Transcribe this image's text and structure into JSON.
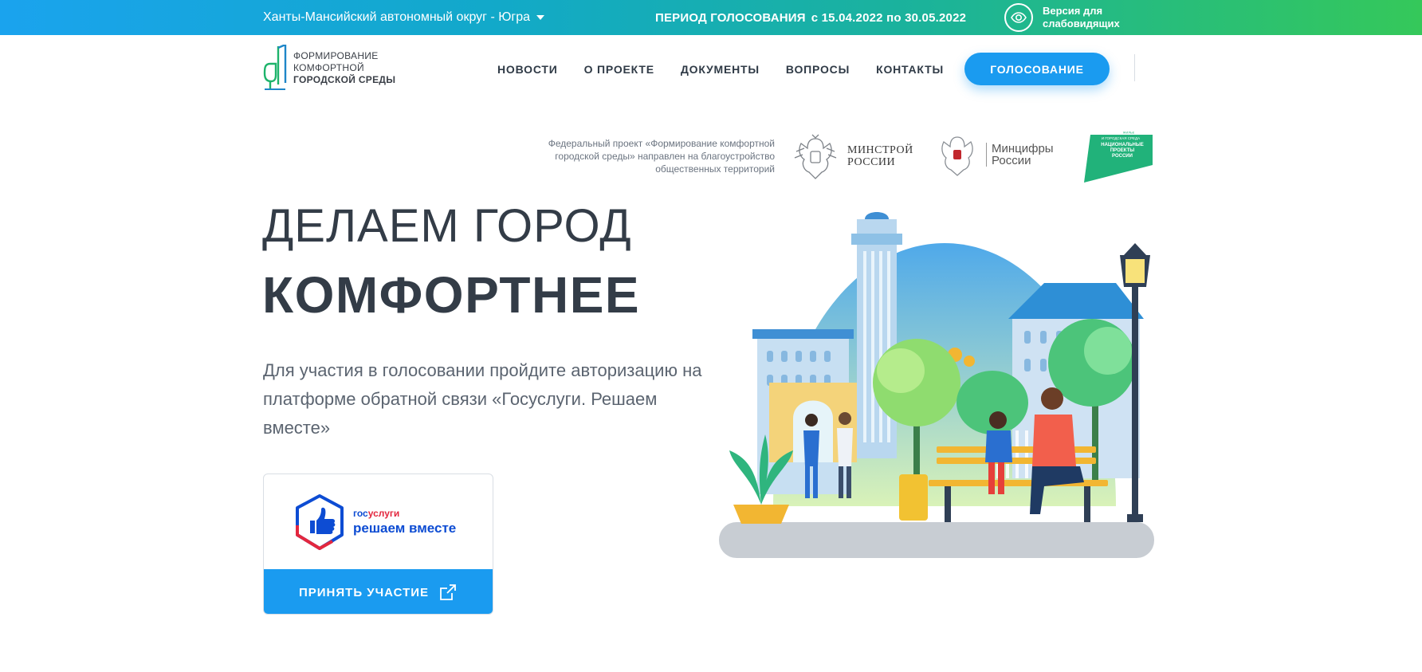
{
  "topbar": {
    "region": "Ханты-Мансийский автономный округ - Югра",
    "period_label": "ПЕРИОД ГОЛОСОВАНИЯ",
    "period_dates": "с 15.04.2022 по 30.05.2022",
    "accessibility_line1": "Версия для",
    "accessibility_line2": "слабовидящих"
  },
  "logo": {
    "line1": "ФОРМИРОВАНИЕ",
    "line2": "КОМФОРТНОЙ",
    "line3": "ГОРОДСКОЙ СРЕДЫ"
  },
  "nav": {
    "items": [
      "НОВОСТИ",
      "О ПРОЕКТЕ",
      "ДОКУМЕНТЫ",
      "ВОПРОСЫ",
      "КОНТАКТЫ"
    ],
    "vote_button": "ГОЛОСОВАНИЕ"
  },
  "partners": {
    "fed_text": "Федеральный проект «Формирование комфортной городской среды» направлен на благоустройство общественных территорий",
    "minstroy_line1": "МИНСТРОЙ",
    "minstroy_line2": "РОССИИ",
    "mincifry_line1": "Минцифры",
    "mincifry_line2": "России",
    "np_line1": "ЖИЛЬЕ",
    "np_line2": "И ГОРОДСКАЯ СРЕДА",
    "np_line3": "НАЦИОНАЛЬНЫЕ",
    "np_line4": "ПРОЕКТЫ",
    "np_line5": "РОССИИ"
  },
  "hero": {
    "title_line1": "ДЕЛАЕМ ГОРОД",
    "title_line2": "КОМФОРТНЕЕ",
    "description": "Для участия в голосовании пройдите авторизацию на платформе обратной связи «Госуслуги. Решаем вместе»"
  },
  "card": {
    "gos_part1": "гос",
    "gos_part2": "услуги",
    "gos_tagline": "решаем вместе",
    "button": "ПРИНЯТЬ УЧАСТИЕ"
  },
  "colors": {
    "accent_blue": "#1a9bf0",
    "gradient_start": "#1aa3ee",
    "gradient_end": "#35c85a",
    "logo_green": "#1db36b",
    "gos_blue": "#0d4cd3",
    "gos_red": "#e3273e"
  },
  "icons": {
    "region_dropdown": "chevron-down-icon",
    "accessibility": "eye-icon",
    "external_link": "external-link-icon",
    "gos_logo": "thumbs-up-icon"
  }
}
